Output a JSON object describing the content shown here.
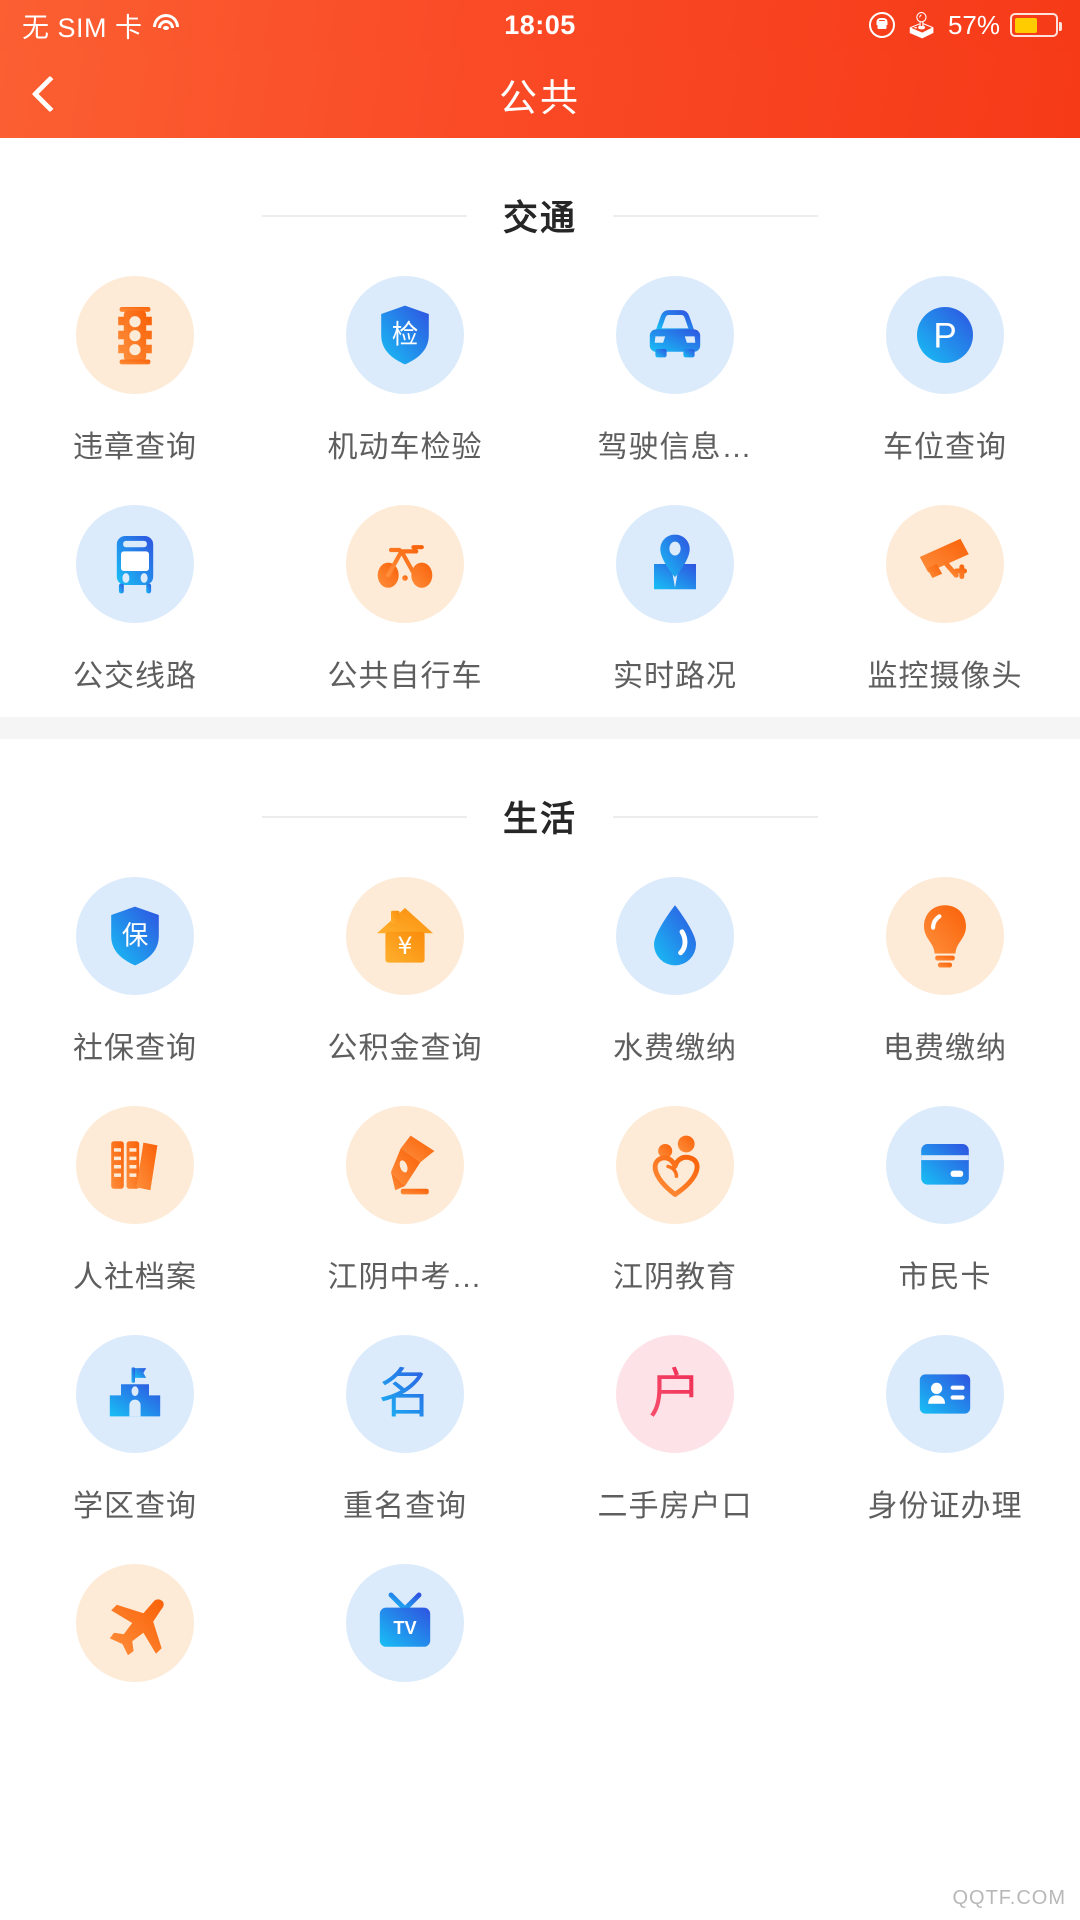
{
  "status_bar": {
    "carrier": "无 SIM 卡",
    "wifi_icon": "wifi-icon",
    "time": "18:05",
    "rotation_lock_icon": "rotation-lock-icon",
    "bluetooth_icon": "bluetooth-icon",
    "battery_percent": "57%",
    "battery_level": 57,
    "battery_fill_color": "#ffcc00"
  },
  "nav_bar": {
    "back_icon": "back-chevron-icon",
    "title": "公共",
    "accent_color": "#fa4a26"
  },
  "sections": [
    {
      "title": "交通",
      "items": [
        {
          "label": "违章查询",
          "icon": "traffic-light-icon",
          "bubble": "#fdebd7",
          "tint": "orange"
        },
        {
          "label": "机动车检验",
          "icon": "shield-inspect-icon",
          "bubble": "#dcebfb",
          "tint": "blue"
        },
        {
          "label": "驾驶信息…",
          "icon": "car-front-icon",
          "bubble": "#dcebfb",
          "tint": "blue"
        },
        {
          "label": "车位查询",
          "icon": "parking-p-icon",
          "bubble": "#dcebfb",
          "tint": "blue"
        },
        {
          "label": "公交线路",
          "icon": "bus-icon",
          "bubble": "#dcebfb",
          "tint": "blue"
        },
        {
          "label": "公共自行车",
          "icon": "bicycle-icon",
          "bubble": "#fdebd7",
          "tint": "orange"
        },
        {
          "label": "实时路况",
          "icon": "map-pin-icon",
          "bubble": "#dcebfb",
          "tint": "blue"
        },
        {
          "label": "监控摄像头",
          "icon": "cctv-camera-icon",
          "bubble": "#fdebd7",
          "tint": "orange"
        }
      ]
    },
    {
      "title": "生活",
      "items": [
        {
          "label": "社保查询",
          "icon": "shield-insurance-icon",
          "bubble": "#dcebfb",
          "tint": "blue"
        },
        {
          "label": "公积金查询",
          "icon": "house-yuan-icon",
          "bubble": "#fdebd7",
          "tint": "orange"
        },
        {
          "label": "水费缴纳",
          "icon": "water-drop-icon",
          "bubble": "#dcebfb",
          "tint": "blue"
        },
        {
          "label": "电费缴纳",
          "icon": "light-bulb-icon",
          "bubble": "#fdebd7",
          "tint": "orange"
        },
        {
          "label": "人社档案",
          "icon": "books-icon",
          "bubble": "#fdebd7",
          "tint": "orange"
        },
        {
          "label": "江阴中考…",
          "icon": "fountain-pen-icon",
          "bubble": "#fdebd7",
          "tint": "orange"
        },
        {
          "label": "江阴教育",
          "icon": "heart-people-icon",
          "bubble": "#fdebd7",
          "tint": "orange"
        },
        {
          "label": "市民卡",
          "icon": "bank-card-icon",
          "bubble": "#dcebfb",
          "tint": "blue"
        },
        {
          "label": "学区查询",
          "icon": "school-flag-icon",
          "bubble": "#dcebfb",
          "tint": "blue"
        },
        {
          "label": "重名查询",
          "icon": "name-ming-icon",
          "bubble": "#dcebfb",
          "tint": "blue"
        },
        {
          "label": "二手房户口",
          "icon": "household-hu-icon",
          "bubble": "#fde3e8",
          "tint": "pink"
        },
        {
          "label": "身份证办理",
          "icon": "id-card-icon",
          "bubble": "#dcebfb",
          "tint": "blue"
        },
        {
          "label": "",
          "icon": "airplane-icon",
          "bubble": "#fdebd7",
          "tint": "orange"
        },
        {
          "label": "",
          "icon": "tv-icon",
          "bubble": "#dcebfb",
          "tint": "blue"
        }
      ]
    }
  ],
  "watermark": "QQTF.COM"
}
